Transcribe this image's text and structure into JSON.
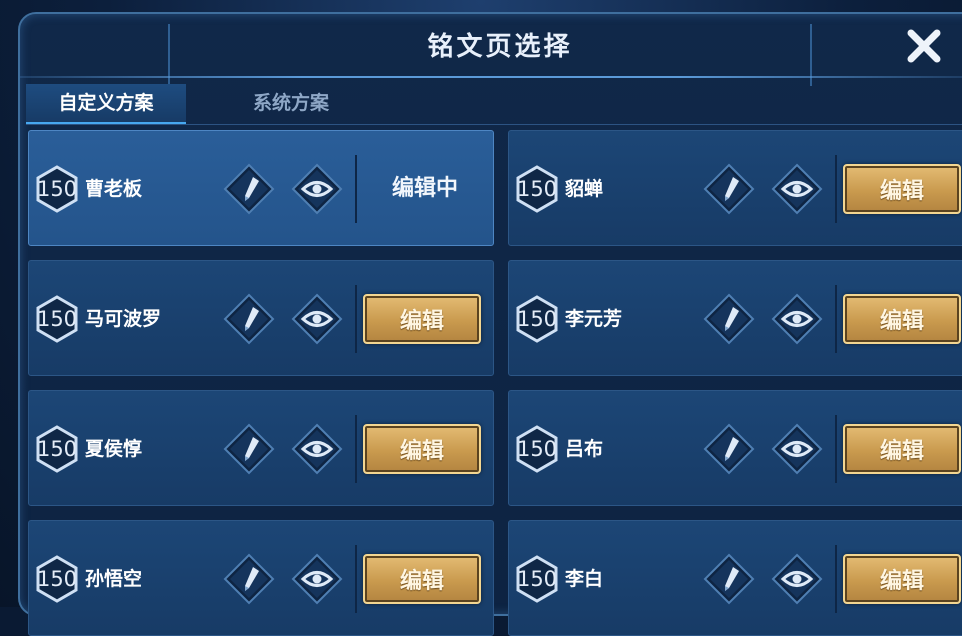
{
  "title": "铭文页选择",
  "tabs": [
    {
      "label": "自定义方案",
      "active": true
    },
    {
      "label": "系统方案",
      "active": false
    }
  ],
  "pages": [
    {
      "level": "150",
      "name": "曹老板",
      "status": "编辑中"
    },
    {
      "level": "150",
      "name": "貂蝉",
      "status": "编辑"
    },
    {
      "level": "150",
      "name": "马可波罗",
      "status": "编辑"
    },
    {
      "level": "150",
      "name": "李元芳",
      "status": "编辑"
    },
    {
      "level": "150",
      "name": "夏侯惇",
      "status": "编辑"
    },
    {
      "level": "150",
      "name": "吕布",
      "status": "编辑"
    },
    {
      "level": "150",
      "name": "孙悟空",
      "status": "编辑"
    },
    {
      "level": "150",
      "name": "李白",
      "status": "编辑"
    }
  ],
  "icons": {
    "close": "close-icon",
    "rename": "pencil-icon",
    "preview": "eye-icon",
    "level": "hexagon-badge-icon"
  },
  "colors": {
    "accent": "#47a8f0",
    "edit_button": "#d0a25a",
    "panel": "#173b66",
    "selected_panel": "#24548b"
  }
}
